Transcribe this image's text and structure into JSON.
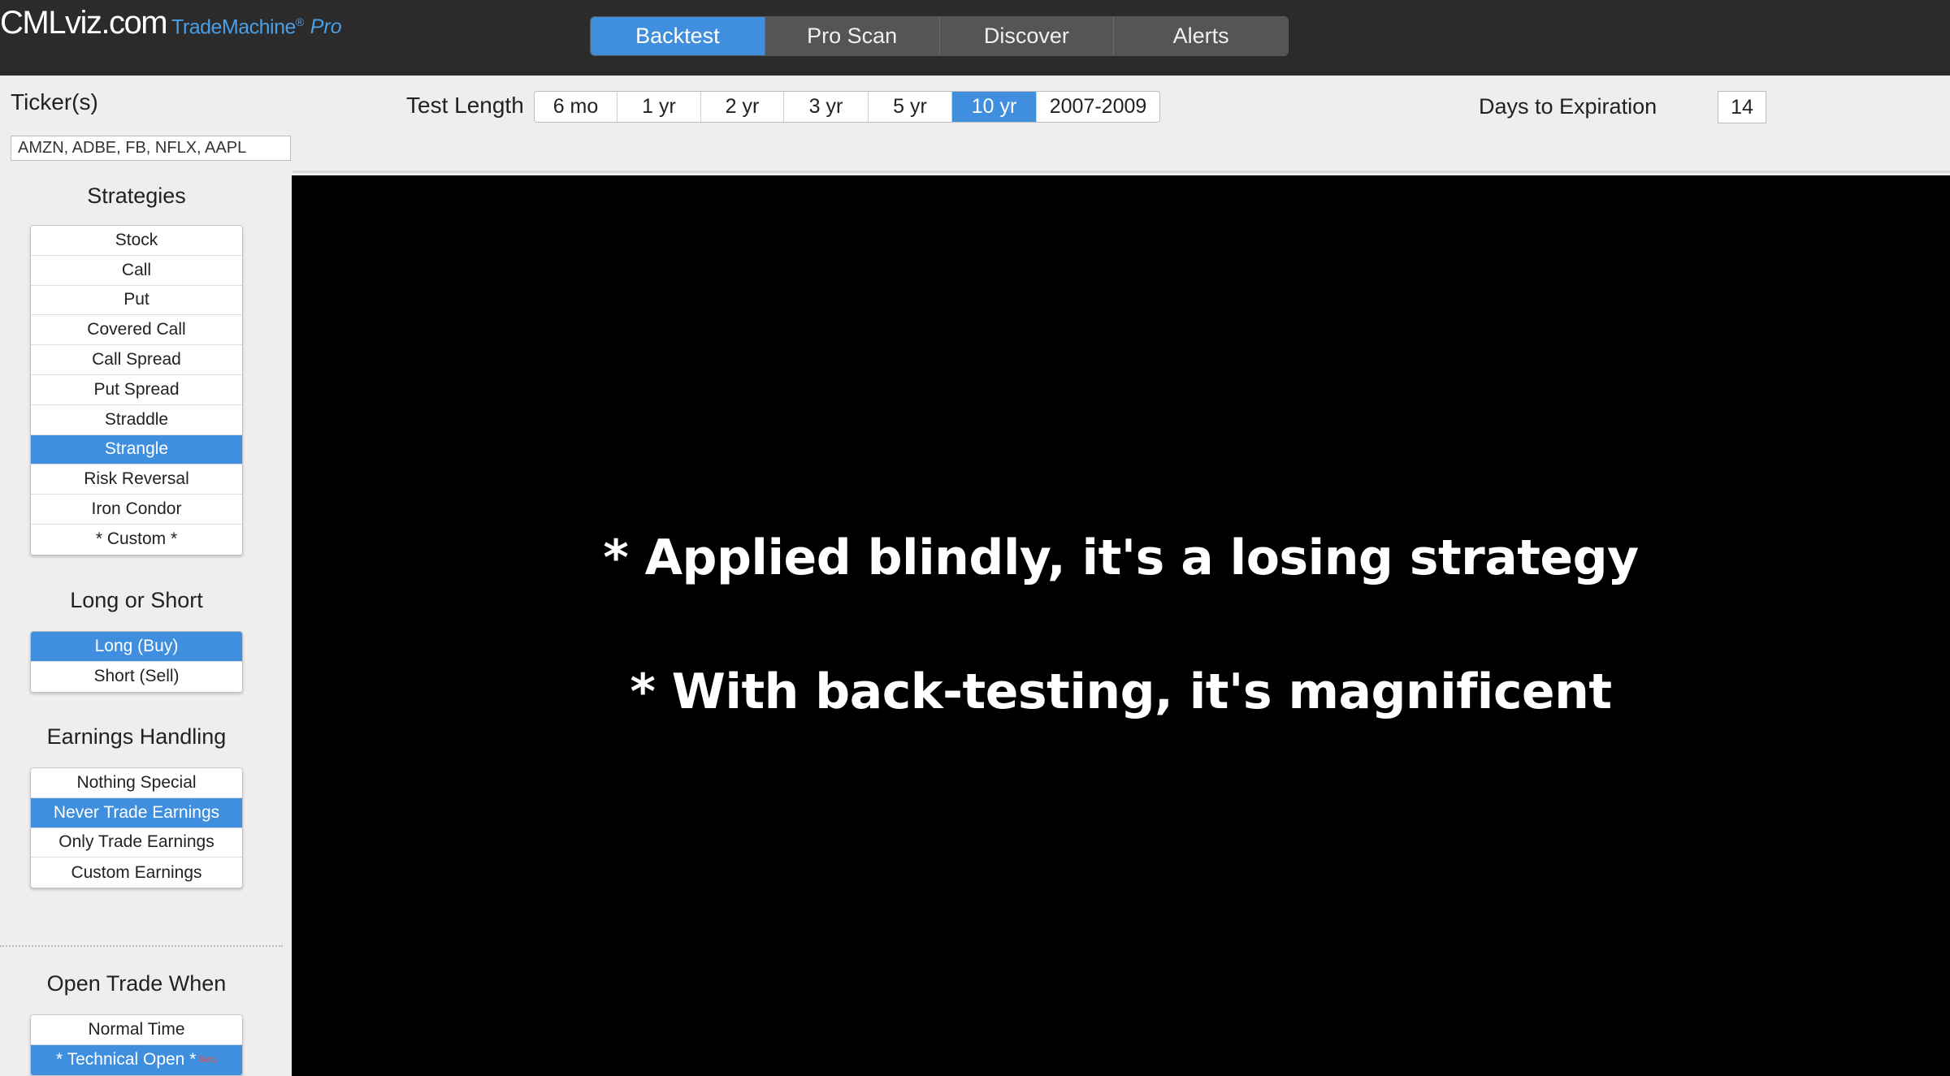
{
  "brand": {
    "main": "CMLviz.com",
    "sub": "TradeMachine",
    "reg": "®",
    "pro": "Pro"
  },
  "nav": {
    "tabs": [
      {
        "label": "Backtest"
      },
      {
        "label": "Pro Scan"
      },
      {
        "label": "Discover"
      },
      {
        "label": "Alerts"
      }
    ]
  },
  "ticker": {
    "label": "Ticker(s)",
    "value": "AMZN, ADBE, FB, NFLX, AAPL"
  },
  "test_length": {
    "label": "Test Length",
    "options": [
      {
        "label": "6 mo"
      },
      {
        "label": "1 yr"
      },
      {
        "label": "2 yr"
      },
      {
        "label": "3 yr"
      },
      {
        "label": "5 yr"
      },
      {
        "label": "10 yr"
      },
      {
        "label": "2007-2009"
      }
    ],
    "selected": "10 yr"
  },
  "days_to_expiration": {
    "label": "Days to Expiration",
    "value": "14"
  },
  "sidebar": {
    "strategies": {
      "title": "Strategies",
      "items": [
        {
          "label": "Stock"
        },
        {
          "label": "Call"
        },
        {
          "label": "Put"
        },
        {
          "label": "Covered Call"
        },
        {
          "label": "Call Spread"
        },
        {
          "label": "Put Spread"
        },
        {
          "label": "Straddle"
        },
        {
          "label": "Strangle"
        },
        {
          "label": "Risk Reversal"
        },
        {
          "label": "Iron Condor"
        },
        {
          "label": "* Custom *"
        }
      ],
      "selected": "Strangle"
    },
    "long_short": {
      "title": "Long or Short",
      "items": [
        {
          "label": "Long (Buy)"
        },
        {
          "label": "Short (Sell)"
        }
      ],
      "selected": "Long (Buy)"
    },
    "earnings": {
      "title": "Earnings Handling",
      "items": [
        {
          "label": "Nothing Special"
        },
        {
          "label": "Never Trade Earnings"
        },
        {
          "label": "Only Trade Earnings"
        },
        {
          "label": "Custom Earnings"
        }
      ],
      "selected": "Never Trade Earnings"
    },
    "open_trade": {
      "title": "Open Trade When",
      "items": [
        {
          "label": "Normal Time"
        },
        {
          "label": "* Technical Open *",
          "tag": "Beta"
        }
      ],
      "selected": "* Technical Open *"
    }
  },
  "overlay": {
    "line1": "* Applied blindly, it's a losing strategy",
    "line2": "* With back-testing, it's magnificent"
  },
  "colors": {
    "accent": "#3f8fde",
    "topbar": "#2b2b2b",
    "brand_blue": "#4a9fe6"
  }
}
